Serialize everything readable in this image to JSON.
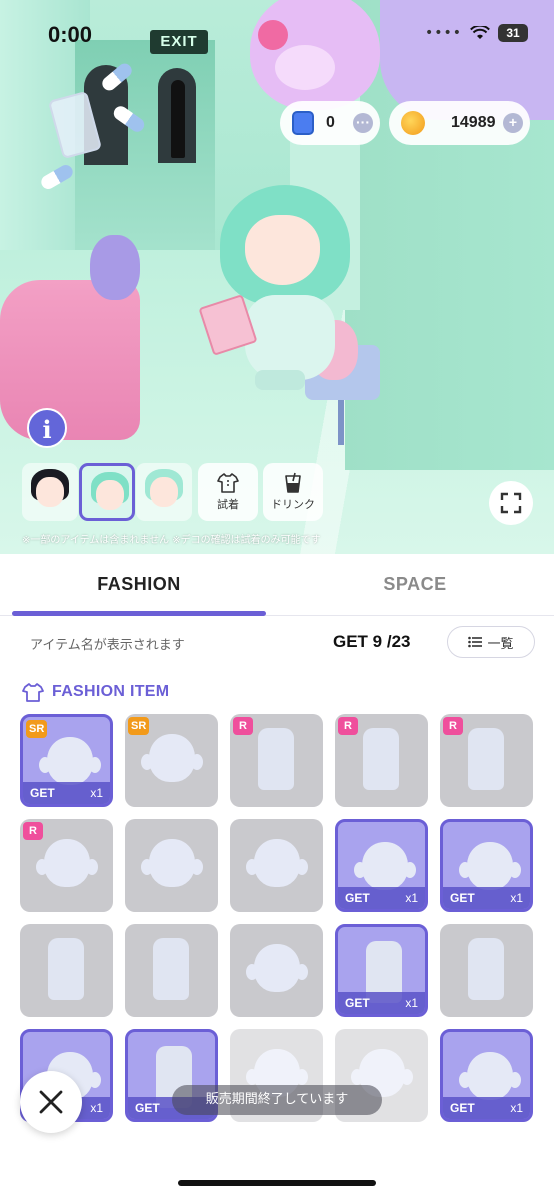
{
  "status_bar": {
    "time": "0:00",
    "signal": "••••",
    "battery": "31"
  },
  "scene": {
    "exit_sign": "EXIT",
    "note": "※一部のアイテムは含まれません ※デコの確認は試着のみ可能です"
  },
  "currency": {
    "tickets": "0",
    "coins": "14989",
    "more_label": "···",
    "add_label": "+"
  },
  "info_button": "i",
  "tools": {
    "try_on": "試着",
    "drink": "ドリンク"
  },
  "tabs": {
    "fashion": "FASHION",
    "space": "SPACE"
  },
  "collection": {
    "item_name_hint": "アイテム名が表示されます",
    "get_count": "GET 9 /23",
    "list_button": "一覧",
    "section_title": "FASHION ITEM"
  },
  "items": [
    {
      "rarity": "SR",
      "owned": true,
      "get": "GET",
      "count": "x1"
    },
    {
      "rarity": "SR",
      "owned": false
    },
    {
      "rarity": "R",
      "owned": false
    },
    {
      "rarity": "R",
      "owned": false
    },
    {
      "rarity": "R",
      "owned": false
    },
    {
      "rarity": "R",
      "owned": false
    },
    {
      "owned": false
    },
    {
      "owned": false
    },
    {
      "owned": true,
      "get": "GET",
      "count": "x1"
    },
    {
      "owned": true,
      "get": "GET",
      "count": "x1"
    },
    {
      "owned": false
    },
    {
      "owned": false
    },
    {
      "owned": false
    },
    {
      "owned": true,
      "get": "GET",
      "count": "x1"
    },
    {
      "owned": false
    },
    {
      "owned": true,
      "count": "x1"
    },
    {
      "owned": true,
      "get": "GET"
    },
    {
      "owned": false
    },
    {
      "owned": false
    },
    {
      "owned": true,
      "get": "GET",
      "count": "x1"
    }
  ],
  "toast": "販売期間終了しています",
  "close_label": "×",
  "colors": {
    "accent": "#6b5fd6",
    "rarity_sr": "#f29a1a",
    "rarity_r": "#ef4f9c"
  }
}
